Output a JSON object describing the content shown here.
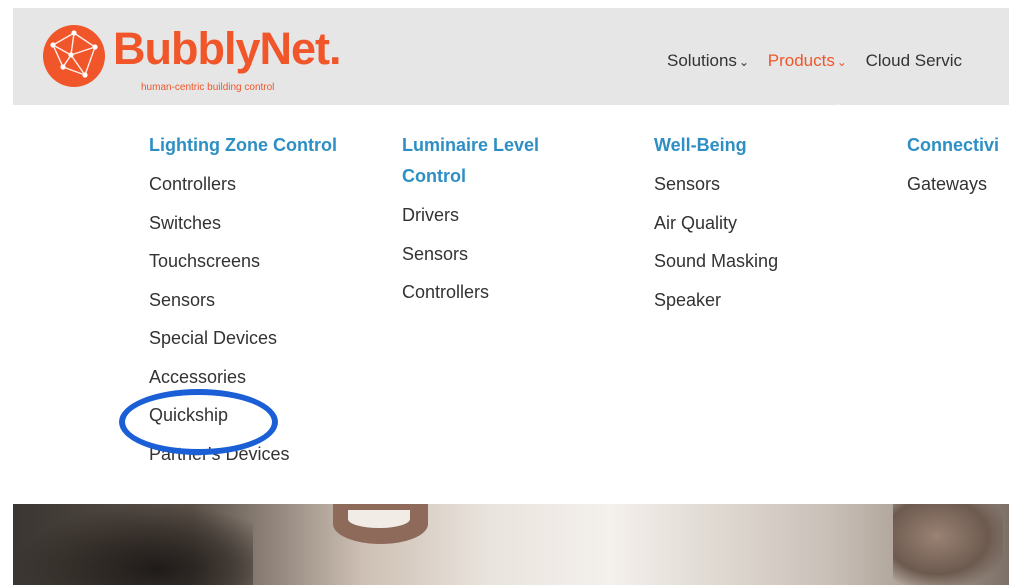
{
  "header": {
    "brand": "BubblyNet",
    "brand_dot": ".",
    "tagline": "human-centric building control",
    "nav": [
      {
        "label": "Solutions",
        "active": false
      },
      {
        "label": "Products",
        "active": true
      },
      {
        "label": "Cloud Servic",
        "active": false
      }
    ],
    "chevron": "⌄"
  },
  "menu": {
    "columns": [
      {
        "title": "Lighting Zone Control",
        "items": [
          "Controllers",
          "Switches",
          "Touchscreens",
          "Sensors",
          "Special Devices",
          "Accessories",
          "Quickship",
          "Partner's Devices"
        ]
      },
      {
        "title_line1": "Luminaire Level",
        "title_line2": "Control",
        "items": [
          "Drivers",
          "Sensors",
          "Controllers"
        ]
      },
      {
        "title": "Well-Being",
        "items": [
          "Sensors",
          "Air Quality",
          "Sound Masking",
          "Speaker"
        ]
      },
      {
        "title": "Connectivi",
        "items": [
          "Gateways"
        ]
      }
    ]
  },
  "colors": {
    "brand": "#f0562a",
    "menu_title": "#2e8fc4",
    "highlight_circle": "#1a5fd6",
    "header_bg": "#e6e6e6"
  }
}
